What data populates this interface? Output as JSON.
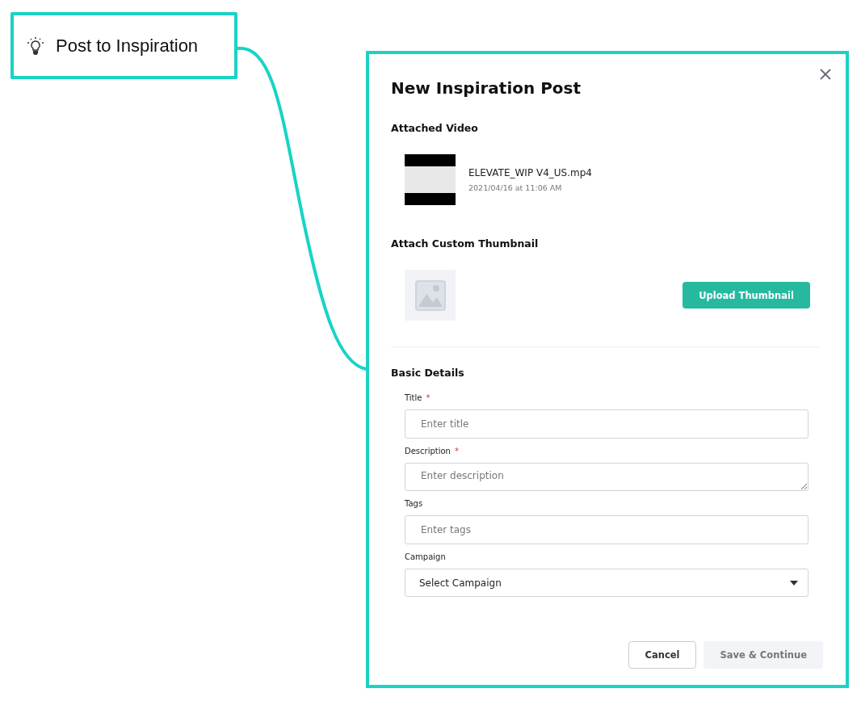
{
  "callout": {
    "label": "Post to Inspiration"
  },
  "dialog": {
    "title": "New Inspiration Post",
    "attached_video": {
      "heading": "Attached Video",
      "file_name": "ELEVATE_WIP V4_US.mp4",
      "date": "2021/04/16 at 11:06 AM"
    },
    "thumbnail": {
      "heading": "Attach Custom Thumbnail",
      "button": "Upload Thumbnail"
    },
    "basic_details": {
      "heading": "Basic Details",
      "fields": [
        {
          "kind": "input",
          "label": "Title",
          "required_mark": "*",
          "placeholder": "Enter title"
        },
        {
          "kind": "textarea",
          "label": "Description",
          "required_mark": "*",
          "placeholder": "Enter description"
        },
        {
          "kind": "input",
          "label": "Tags",
          "placeholder": "Enter tags"
        },
        {
          "kind": "select",
          "label": "Campaign",
          "value": "Select Campaign"
        }
      ]
    },
    "buttons": [
      {
        "label": "Cancel",
        "kind": "secondary",
        "disabled": false
      },
      {
        "label": "Save & Continue",
        "kind": "primary",
        "disabled": true
      }
    ]
  }
}
